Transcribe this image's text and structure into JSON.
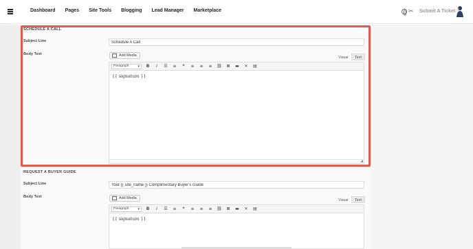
{
  "nav": {
    "items": [
      "Dashboard",
      "Pages",
      "Site Tools",
      "Blogging",
      "Lead Manager",
      "Marketplace"
    ],
    "submit_ticket": "Submit A Ticket"
  },
  "section1": {
    "title": "SCHEDULE A CALL",
    "subject_label": "Subject Line",
    "subject_value": "Schedule A Call",
    "body_label": "Body Text",
    "add_media": "Add Media",
    "tab_visual": "Visual",
    "tab_text": "Text",
    "format": "Paragraph",
    "content": "{{ signature }}"
  },
  "section2": {
    "title": "REQUEST A BUYER GUIDE",
    "subject_label": "Subject Line",
    "subject_value": "Your {{ site_name }} Complimentary Buyer's Guide",
    "body_label": "Body Text",
    "add_media": "Add Media",
    "tab_visual": "Visual",
    "tab_text": "Text",
    "format": "Paragraph",
    "content": "{{ signature }}"
  },
  "toolbar_icons": [
    "bold-icon",
    "italic-icon",
    "bullet-list-icon",
    "numbered-list-icon",
    "blockquote-icon",
    "align-left-icon",
    "align-center-icon",
    "align-right-icon",
    "link-icon",
    "unlink-icon",
    "read-more-icon",
    "fullscreen-icon",
    "toolbar-toggle-icon"
  ],
  "colors": {
    "highlight": "#e05a4e",
    "nav_text": "#222222"
  }
}
